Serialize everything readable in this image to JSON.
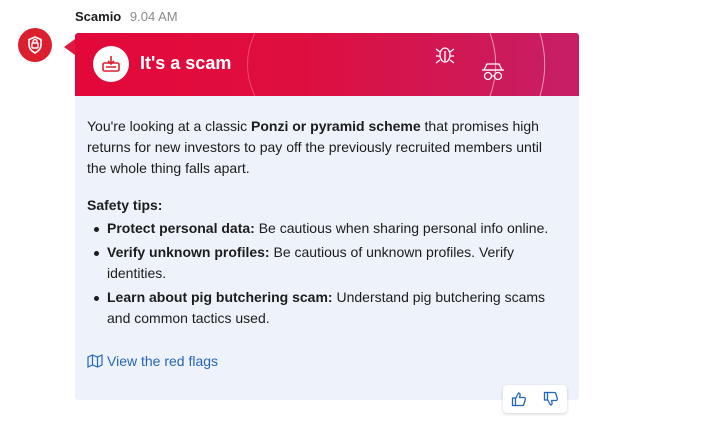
{
  "sender": {
    "name": "Scamio",
    "time": "9.04 AM"
  },
  "banner": {
    "title": "It's a scam"
  },
  "message": {
    "intro_1": "You're looking at a classic ",
    "intro_bold": "Ponzi or pyramid scheme",
    "intro_2": " that promises high returns for new investors to pay off the previously recruited members until the whole thing falls apart."
  },
  "tips": {
    "title": "Safety tips:",
    "items": [
      {
        "label": "Protect personal data:",
        "text": " Be cautious when sharing personal info online."
      },
      {
        "label": "Verify unknown profiles:",
        "text": " Be cautious of unknown profiles. Verify identities."
      },
      {
        "label": "Learn about pig butchering scam:",
        "text": " Understand pig butchering scams and common tactics used."
      }
    ]
  },
  "link": {
    "label": "View the red flags"
  },
  "colors": {
    "brand_red": "#dc1f2e",
    "link_blue": "#2366b8",
    "card_bg": "#eef3fb"
  },
  "icons": {
    "avatar": "shield-icon",
    "badge": "scam-alert-icon",
    "deco": [
      "bug-icon",
      "spy-icon"
    ],
    "link": "map-icon",
    "feedback": [
      "thumbs-up-icon",
      "thumbs-down-icon"
    ]
  }
}
